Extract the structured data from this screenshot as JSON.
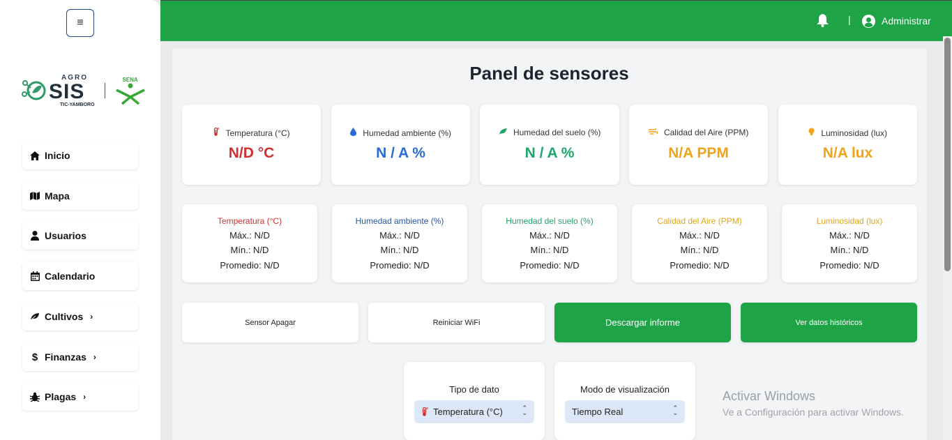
{
  "sidebar": {
    "toggle_icon": "hamburger-icon",
    "logo": {
      "agro": "AGRO",
      "sis": "SIS",
      "sub": "TIC-YAMBORO",
      "sena": "SENA"
    },
    "items": [
      {
        "label": "Inicio",
        "icon": "home-icon",
        "has_submenu": false
      },
      {
        "label": "Mapa",
        "icon": "map-icon",
        "has_submenu": false
      },
      {
        "label": "Usuarios",
        "icon": "user-icon",
        "has_submenu": false
      },
      {
        "label": "Calendario",
        "icon": "calendar-icon",
        "has_submenu": false
      },
      {
        "label": "Cultivos",
        "icon": "leaf-icon",
        "has_submenu": true
      },
      {
        "label": "Finanzas",
        "icon": "dollar-icon",
        "has_submenu": true
      },
      {
        "label": "Plagas",
        "icon": "bug-icon",
        "has_submenu": true
      }
    ]
  },
  "header": {
    "separator": "|",
    "user_name": "Administrar",
    "accent": "#1ea446"
  },
  "main": {
    "title": "Panel de sensores",
    "sensors": [
      {
        "label": "Temperatura (°C)",
        "value": "N/D °C",
        "color": "#d0302f",
        "icon": "thermometer-icon"
      },
      {
        "label": "Humedad ambiente (%)",
        "value": "N / A %",
        "color": "#2b6cd4",
        "icon": "droplet-icon"
      },
      {
        "label": "Humedad del suelo (%)",
        "value": "N / A %",
        "color": "#1fa46a",
        "icon": "leaf-icon"
      },
      {
        "label": "Calidad del Aire (PPM)",
        "value": "N/A PPM",
        "color": "#f0a41c",
        "icon": "wind-icon"
      },
      {
        "label": "Luminosidad (lux)",
        "value": "N/A lux",
        "color": "#f0a41c",
        "icon": "lightbulb-icon"
      }
    ],
    "stats": [
      {
        "title": "Temperatura (°C)",
        "color": "#d0302f",
        "max": "Máx.: N/D",
        "min": "Mín.: N/D",
        "avg": "Promedio: N/D"
      },
      {
        "title": "Humedad ambiente (%)",
        "color": "#2855a6",
        "max": "Máx.: N/D",
        "min": "Mín.: N/D",
        "avg": "Promedio: N/D"
      },
      {
        "title": "Humedad del suelo (%)",
        "color": "#1fa46a",
        "max": "Máx.: N/D",
        "min": "Mín.: N/D",
        "avg": "Promedio: N/D"
      },
      {
        "title": "Calidad del Aire (PPM)",
        "color": "#e3a514",
        "max": "Máx.: N/D",
        "min": "Mín.: N/D",
        "avg": "Promedio: N/D"
      },
      {
        "title": "Luminosidad (lux)",
        "color": "#e3a514",
        "max": "Máx.: N/D",
        "min": "Mín.: N/D",
        "avg": "Promedio: N/D"
      }
    ],
    "actions": [
      {
        "label": "Sensor Apagar"
      },
      {
        "label": "Reiniciar WiFi"
      },
      {
        "label": "Descargar informe"
      },
      {
        "label": "Ver datos históricos"
      }
    ],
    "data_type": {
      "label": "Tipo de dato",
      "selected": "Temperatura (°C)"
    },
    "view_mode": {
      "label": "Modo de visualización",
      "selected": "Tiempo Real"
    }
  },
  "watermark": {
    "title": "Activar Windows",
    "subtitle": "Ve a Configuración para activar Windows."
  }
}
